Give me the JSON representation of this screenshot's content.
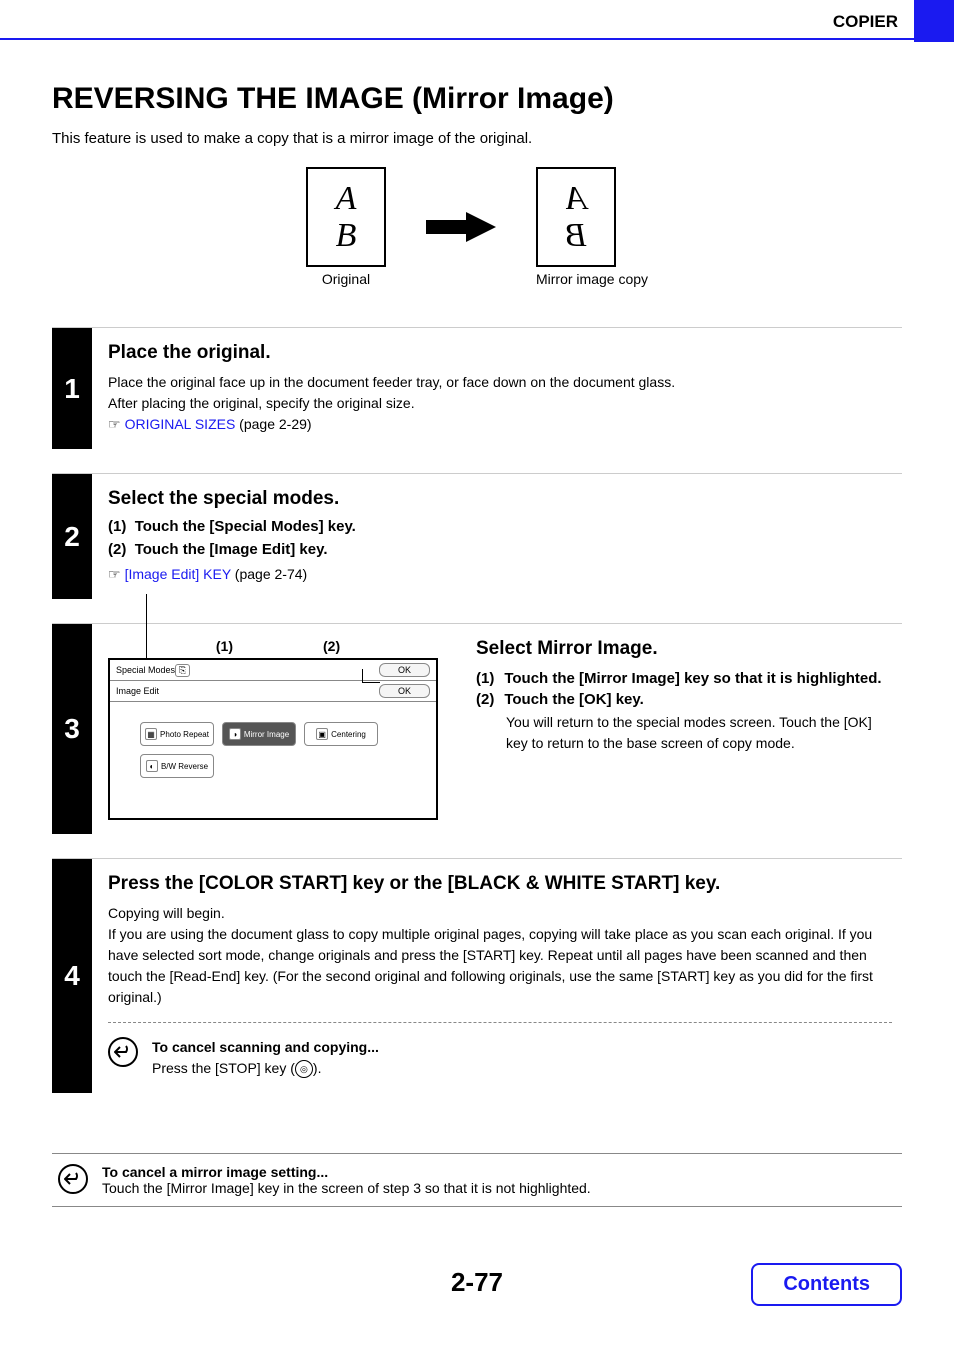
{
  "header": {
    "section": "COPIER"
  },
  "title": "REVERSING THE IMAGE (Mirror Image)",
  "intro": "This feature is used to make a copy that is a mirror image of the original.",
  "diagram": {
    "letterA": "A",
    "letterB": "B",
    "caption_left": "Original",
    "caption_right": "Mirror image copy"
  },
  "steps": {
    "s1": {
      "num": "1",
      "title": "Place the original.",
      "body1": "Place the original face up in the document feeder tray, or face down on the document glass.",
      "body2": "After placing the original, specify the original size.",
      "ref_icon": "☞",
      "link": "ORIGINAL SIZES",
      "link_page": " (page 2-29)"
    },
    "s2": {
      "num": "2",
      "title": "Select the special modes.",
      "item1_num": "(1)",
      "item1": "Touch the [Special Modes] key.",
      "item2_num": "(2)",
      "item2": "Touch the [Image Edit] key.",
      "ref_icon": "☞",
      "link": "[Image Edit] KEY",
      "link_page": " (page 2-74)"
    },
    "s3": {
      "num": "3",
      "label1": "(1)",
      "label2": "(2)",
      "screen": {
        "row1_label": "Special Modes",
        "row2_label": "Image Edit",
        "ok": "OK",
        "btn_photo": "Photo Repeat",
        "btn_mirror": "Mirror Image",
        "btn_center": "Centering",
        "btn_bw": "B/W Reverse"
      },
      "right": {
        "title": "Select Mirror Image.",
        "i1_num": "(1)",
        "i1": "Touch the [Mirror Image] key so that it is highlighted.",
        "i2_num": "(2)",
        "i2": "Touch the [OK] key.",
        "i2_body": "You will return to the special modes screen. Touch the [OK] key to return to the base screen of copy mode."
      }
    },
    "s4": {
      "num": "4",
      "title": "Press the [COLOR START] key or the [BLACK & WHITE START] key.",
      "body1": "Copying will begin.",
      "body2": "If you are using the document glass to copy multiple original pages, copying will take place as you scan each original. If you have selected sort mode, change originals and press the [START] key. Repeat until all pages have been scanned and then touch the [Read-End] key. (For the second original and following originals, use the same [START] key as you did for the first original.)",
      "cancel_title": "To cancel scanning and copying...",
      "cancel_body_a": "Press the [STOP] key (",
      "cancel_body_b": ")."
    }
  },
  "bottom_cancel": {
    "title": "To cancel a mirror image setting...",
    "body": "Touch the [Mirror Image] key in the screen of step 3 so that it is not highlighted."
  },
  "footer": {
    "page": "2-77",
    "contents": "Contents"
  }
}
